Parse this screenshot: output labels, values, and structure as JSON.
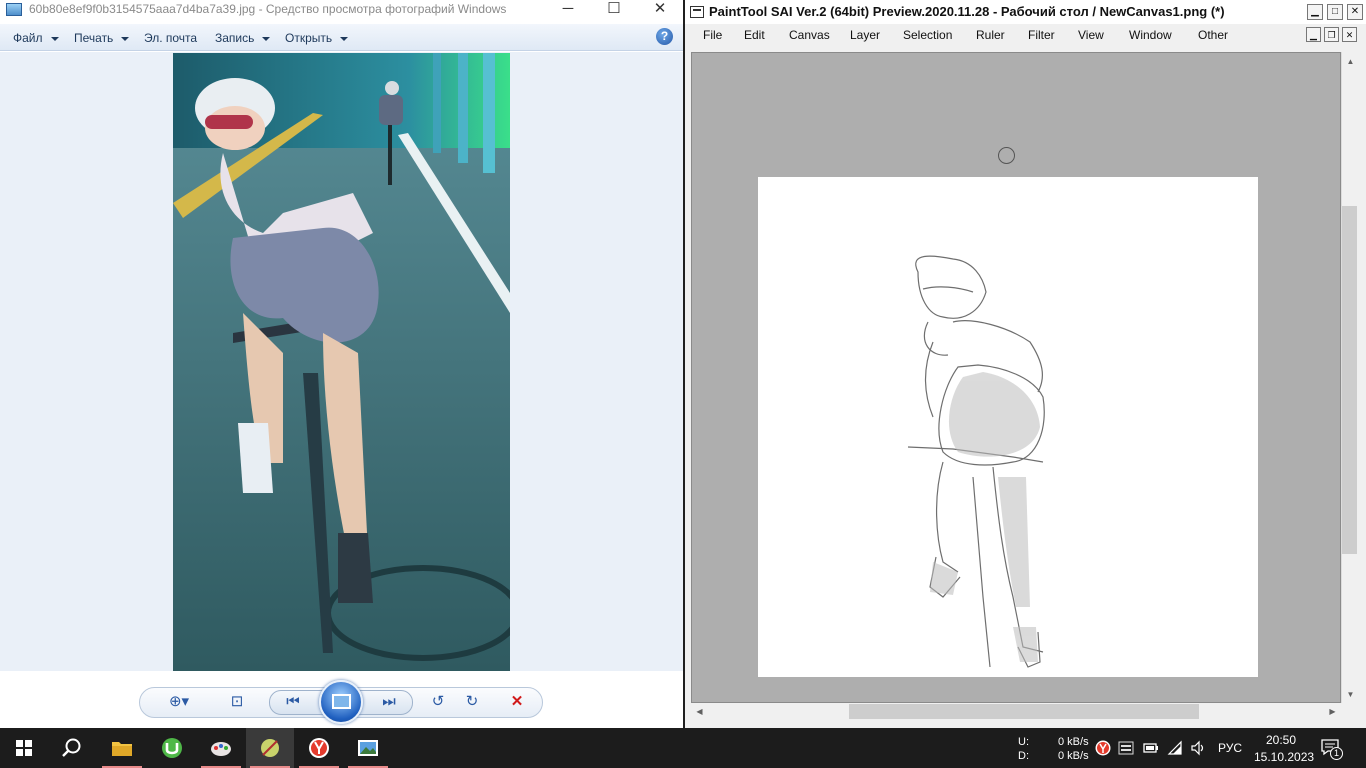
{
  "viewer": {
    "title": "60b80e8ef9f0b3154575aaa7d4ba7a39.jpg - Средство просмотра фотографий Windows",
    "menu": [
      {
        "label": "Файл",
        "has_caret": true
      },
      {
        "label": "Печать",
        "has_caret": true
      },
      {
        "label": "Эл. почта",
        "has_caret": false
      },
      {
        "label": "Запись",
        "has_caret": true
      },
      {
        "label": "Открыть",
        "has_caret": true
      }
    ],
    "help_label": "?",
    "window_buttons": {
      "minimize": "─",
      "maximize": "☐",
      "close": "✕"
    },
    "controls": [
      "zoom",
      "fit-to-window",
      "previous",
      "slideshow",
      "next",
      "rotate-counterclockwise",
      "rotate-clockwise",
      "delete"
    ]
  },
  "sai": {
    "title": "PaintTool SAI Ver.2 (64bit) Preview.2020.11.28 - Рабочий стол / NewCanvas1.png (*)",
    "menu": [
      "File",
      "Edit",
      "Canvas",
      "Layer",
      "Selection",
      "Ruler",
      "Filter",
      "View",
      "Window",
      "Other"
    ],
    "canvas_name": "NewCanvas1.png"
  },
  "taskbar": {
    "apps": [
      "start",
      "search",
      "file-explorer",
      "utorrent",
      "paint-app",
      "paint-tool-sai",
      "yandex-browser",
      "photo-viewer"
    ],
    "network": {
      "upload_label": "U:",
      "download_label": "D:",
      "upload_value": "0 kB/s",
      "download_value": "0 kB/s"
    },
    "language": "РУС",
    "time": "20:50",
    "date": "15.10.2023",
    "notification_count": "1"
  },
  "colors": {
    "viewer_stage": "#eaf0f8",
    "sai_canvas_bg": "#aeaeae",
    "taskbar": "#1c1c1c",
    "delete_red": "#d11a1a"
  }
}
